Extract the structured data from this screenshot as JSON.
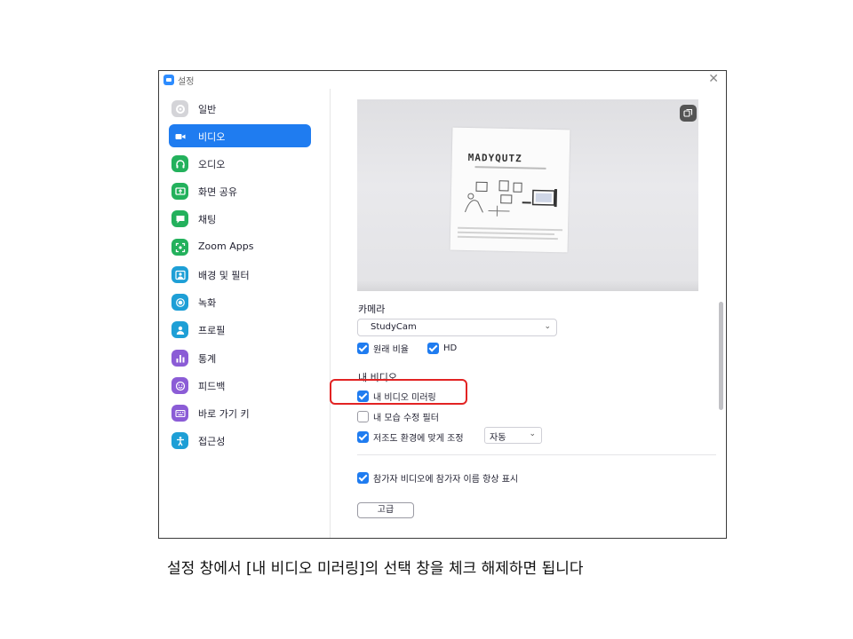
{
  "window": {
    "title": "설정",
    "close_symbol": "✕"
  },
  "sidebar": {
    "items": [
      {
        "label": "일반",
        "icon": "gear-icon",
        "color": "#d4d4d8",
        "active": false
      },
      {
        "label": "비디오",
        "icon": "video-camera-icon",
        "color": "#ffffff",
        "active": true
      },
      {
        "label": "오디오",
        "icon": "headphones-icon",
        "color": "#23b15c",
        "active": false
      },
      {
        "label": "화면 공유",
        "icon": "screen-share-icon",
        "color": "#23b15c",
        "active": false
      },
      {
        "label": "채팅",
        "icon": "chat-bubble-icon",
        "color": "#23b15c",
        "active": false
      },
      {
        "label": "Zoom Apps",
        "icon": "apps-icon",
        "color": "#23b15c",
        "active": false
      },
      {
        "label": "배경 및 필터",
        "icon": "background-person-icon",
        "color": "#1e9fd6",
        "active": false
      },
      {
        "label": "녹화",
        "icon": "record-icon",
        "color": "#1e9fd6",
        "active": false
      },
      {
        "label": "프로필",
        "icon": "profile-icon",
        "color": "#1e9fd6",
        "active": false
      },
      {
        "label": "통계",
        "icon": "statistics-icon",
        "color": "#8b5cd6",
        "active": false
      },
      {
        "label": "피드백",
        "icon": "feedback-smile-icon",
        "color": "#8b5cd6",
        "active": false
      },
      {
        "label": "바로 가기 키",
        "icon": "keyboard-icon",
        "color": "#8b5cd6",
        "active": false
      },
      {
        "label": "접근성",
        "icon": "accessibility-icon",
        "color": "#1e9fd6",
        "active": false
      }
    ]
  },
  "preview": {
    "paper_logo": "MADYQUTZ"
  },
  "camera": {
    "section_title": "카메라",
    "selected": "StudyCam"
  },
  "options": {
    "original_ratio": {
      "label": "원래 비율",
      "checked": true
    },
    "hd": {
      "label": "HD",
      "checked": true
    }
  },
  "my_video": {
    "section_title": "내 비디오",
    "mirror": {
      "label": "내 비디오 미러링",
      "checked": true
    },
    "touch_up": {
      "label": "내 모습 수정 필터",
      "checked": false
    },
    "low_light": {
      "label": "저조도 환경에 맞게 조정",
      "checked": true,
      "mode": "자동"
    }
  },
  "participants": {
    "show_names": {
      "label": "참가자 비디오에 참가자 이름 항상 표시",
      "checked": true
    }
  },
  "advanced_button": "고급",
  "caption": "설정 창에서 [내 비디오 미러링]의 선택 창을 체크 해제하면 됩니다",
  "colors": {
    "accent": "#1f7cf0",
    "highlight": "#e22323"
  }
}
